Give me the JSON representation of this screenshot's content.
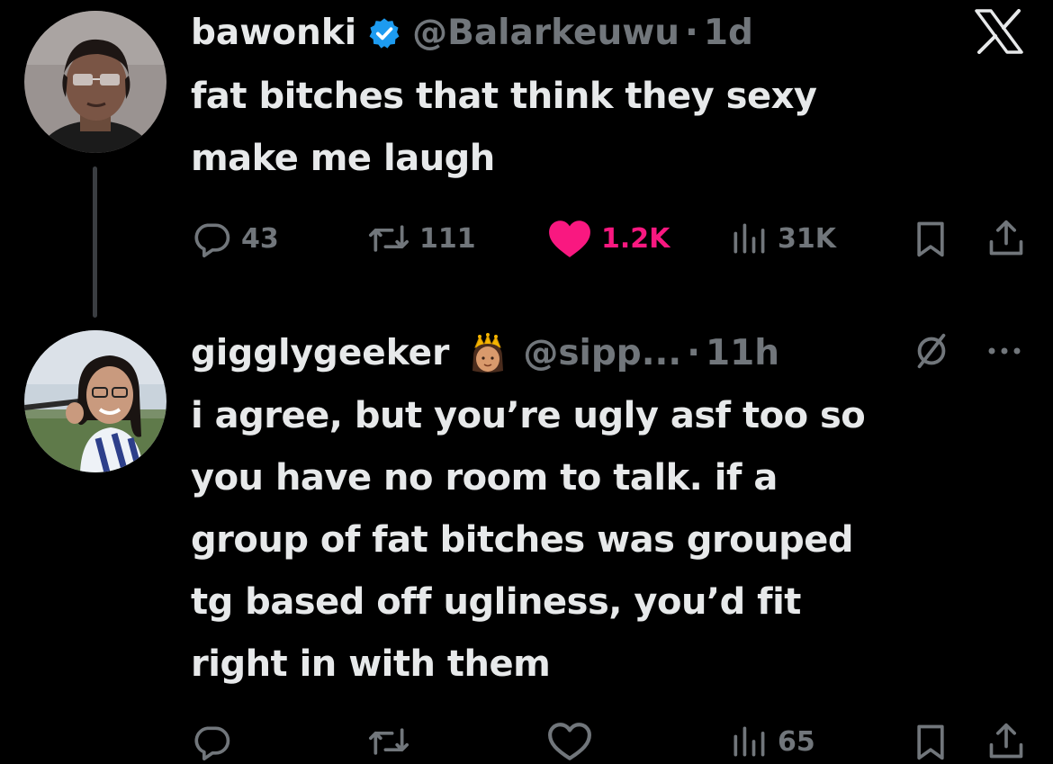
{
  "icons": {
    "x_logo": "x-logo-icon",
    "verified": "verified-badge-icon",
    "crown": "princess-emoji-icon",
    "reply": "reply-icon",
    "retweet": "retweet-icon",
    "like": "heart-icon",
    "views": "views-icon",
    "bookmark": "bookmark-icon",
    "share": "share-icon",
    "note": "slashed-circle-icon",
    "more": "more-icon"
  },
  "colors": {
    "background": "#000000",
    "text": "#e7e9ea",
    "muted": "#71767b",
    "like_active": "#f91880",
    "verified": "#1d9bf0"
  },
  "tweet": {
    "display_name": "bawonki",
    "handle": "@Balarkeuwu",
    "separator": "·",
    "time": "1d",
    "text_lines": [
      "fat bitches that think they sexy",
      "make me laugh"
    ],
    "actions": {
      "replies": "43",
      "retweets": "111",
      "likes": "1.2K",
      "views": "31K"
    }
  },
  "reply": {
    "display_name": "gigglygeeker",
    "handle": "@sipp...",
    "separator": "·",
    "time": "11h",
    "text_lines": [
      "i agree, but you’re ugly asf too so",
      "you have no room to talk. if a",
      "group of fat bitches was grouped",
      "tg based off ugliness, you’d fit",
      "right in with them"
    ],
    "actions": {
      "views": "65"
    }
  }
}
